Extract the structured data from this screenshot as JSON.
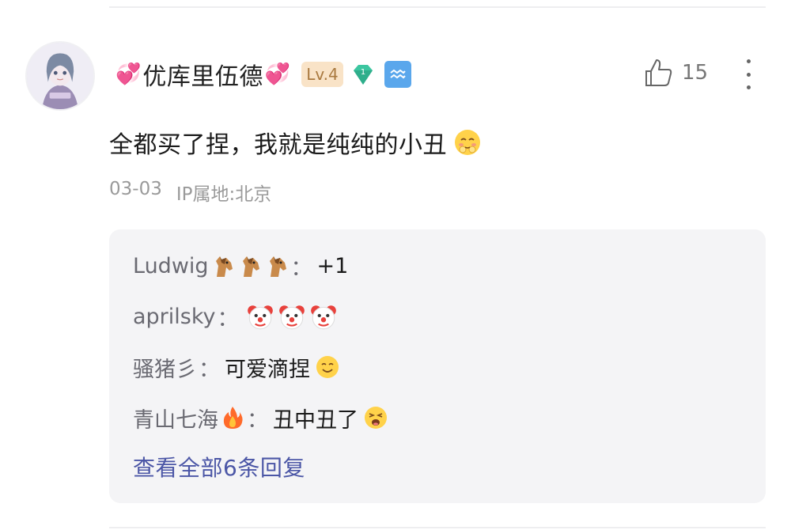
{
  "comment": {
    "username": "优库里伍德",
    "level": "Lv.4",
    "gem_badge": "1",
    "like_count": "15",
    "text": "全都买了捏，我就是纯纯的小丑",
    "date": "03-03",
    "location": "IP属地:北京",
    "icons": {
      "heart": "sparkling-heart-icon",
      "gem": "gem-icon",
      "zodiac": "aquarius-icon",
      "like": "thumbs-up-icon",
      "more": "more-vertical-icon",
      "text_emoji": "shy-face-emoji"
    }
  },
  "replies": [
    {
      "author": "Ludwig",
      "author_emojis": [
        "horse-emoji",
        "horse-emoji",
        "horse-emoji"
      ],
      "separator": "：",
      "content": "+1",
      "content_emojis": []
    },
    {
      "author": "aprilsky",
      "author_emojis": [],
      "separator": "：",
      "content": "",
      "content_emojis": [
        "clown-emoji",
        "clown-emoji",
        "clown-emoji"
      ]
    },
    {
      "author": "骚猪彡",
      "author_emojis": [],
      "separator": "：",
      "content": "可爱滴捏",
      "content_emojis": [
        "smiling-emoji"
      ]
    },
    {
      "author": "青山七海",
      "author_emojis": [
        "fire-emoji"
      ],
      "separator": "：",
      "content": "丑中丑了",
      "content_emojis": [
        "grinning-emoji"
      ]
    }
  ],
  "view_all": "查看全部6条回复",
  "colors": {
    "link": "#4b56a6",
    "level_bg": "#f9e3c7",
    "level_text": "#a9793f",
    "gem": "#3cc6a0",
    "zodiac_bg": "#5aa7ec",
    "reply_bg": "#f4f4f6"
  }
}
